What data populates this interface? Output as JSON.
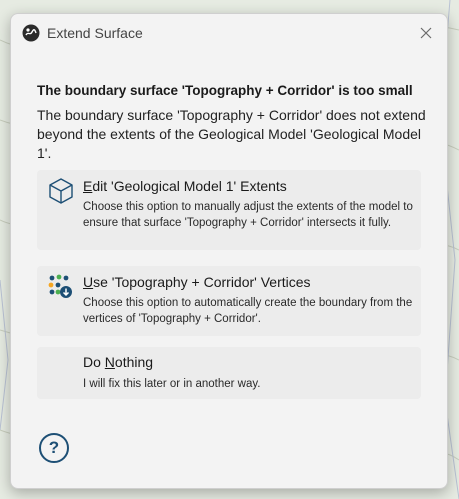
{
  "window": {
    "title": "Extend Surface",
    "app_icon": "app-logo-icon",
    "close_icon": "close-icon"
  },
  "heading": "The boundary surface 'Topography + Corridor' is too small",
  "message": "The boundary surface 'Topography + Corridor' does not extend beyond the extents of the Geological Model 'Geological Model 1'.",
  "options": [
    {
      "mnemonic": "E",
      "title_rest": "dit 'Geological Model 1' Extents",
      "description": "Choose this option to manually adjust the extents of the model to ensure that surface 'Topography + Corridor' intersects it fully.",
      "icon": "cube-icon"
    },
    {
      "mnemonic": "U",
      "title_rest": "se 'Topography + Corridor' Vertices",
      "description": "Choose this option to automatically create the boundary from the vertices of 'Topography + Corridor'.",
      "icon": "vertices-icon"
    },
    {
      "title_prefix": "Do ",
      "mnemonic": "N",
      "title_rest": "othing",
      "description": "I will fix this later or in another way."
    }
  ],
  "help": {
    "label": "?",
    "icon": "help-icon"
  },
  "colors": {
    "dialog_bg": "#f3f3f3",
    "option_bg": "#ececec",
    "icon_blue": "#1d4f75",
    "accent_green": "#4caf50",
    "accent_orange": "#f5a623"
  }
}
